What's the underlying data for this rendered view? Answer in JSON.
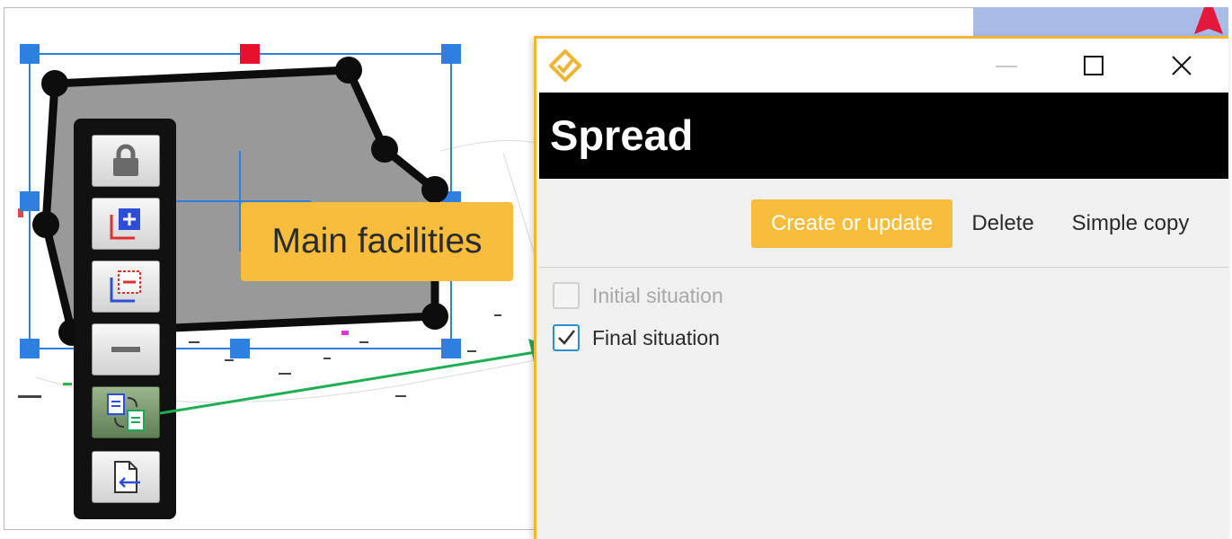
{
  "tag": {
    "label": "Main facilities"
  },
  "toolbar": {
    "buttons": [
      {
        "name": "lock-button",
        "icon": "lock-icon"
      },
      {
        "name": "add-button",
        "icon": "add-layer-icon"
      },
      {
        "name": "remove-layer-button",
        "icon": "remove-layer-icon"
      },
      {
        "name": "minus-button",
        "icon": "minus-icon"
      },
      {
        "name": "spread-button",
        "icon": "spread-copy-icon",
        "active": true
      },
      {
        "name": "import-button",
        "icon": "file-import-icon"
      }
    ]
  },
  "dialog": {
    "title": "Spread",
    "actions": {
      "create_label": "Create or update",
      "delete_label": "Delete",
      "copy_label": "Simple copy"
    },
    "options": {
      "initial_label": "Initial situation",
      "initial_checked": false,
      "initial_enabled": false,
      "final_label": "Final situation",
      "final_checked": true
    }
  },
  "colors": {
    "accent": "#f8bd3c",
    "selection": "#2f7fe0",
    "arrow": "#1fae54"
  }
}
